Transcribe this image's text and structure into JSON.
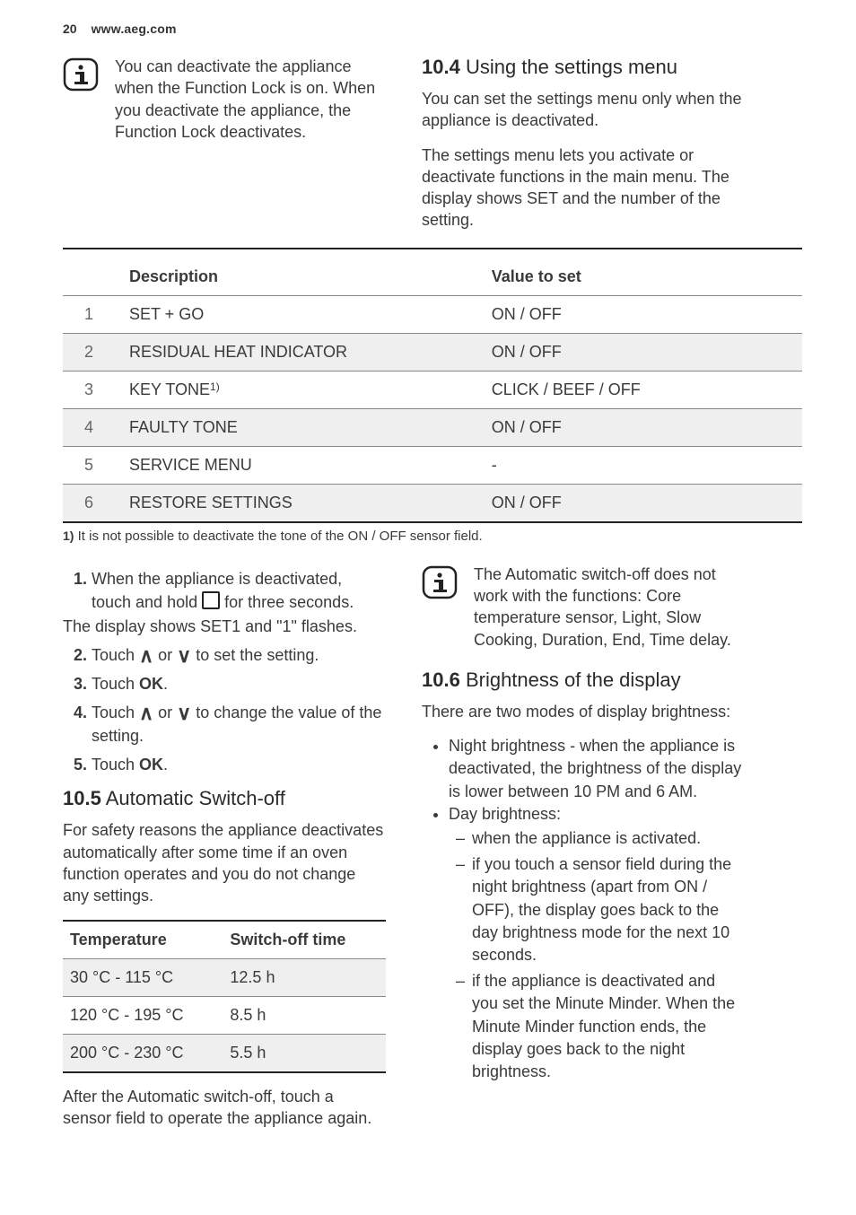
{
  "header": {
    "page": "20",
    "url": "www.aeg.com"
  },
  "note_top": "You can deactivate the appliance when the Function Lock is on. When you deactivate the appliance, the Function Lock deactivates.",
  "s104": {
    "num": "10.4",
    "title": "Using the settings menu",
    "p1": "You can set the settings menu only when the appliance is deactivated.",
    "p2": "The settings menu lets you activate or deactivate functions in the main menu. The display shows SET and the number of the setting."
  },
  "settings_table": {
    "h_blank": "",
    "h_desc": "Description",
    "h_val": "Value to set",
    "rows": [
      {
        "n": "1",
        "desc": "SET + GO",
        "val": "ON / OFF"
      },
      {
        "n": "2",
        "desc": "RESIDUAL HEAT INDICATOR",
        "val": "ON / OFF"
      },
      {
        "n": "3",
        "desc": "KEY TONE",
        "sup": "1)",
        "val": "CLICK / BEEF / OFF"
      },
      {
        "n": "4",
        "desc": "FAULTY TONE",
        "val": "ON / OFF"
      },
      {
        "n": "5",
        "desc": "SERVICE MENU",
        "val": "-"
      },
      {
        "n": "6",
        "desc": "RESTORE SETTINGS",
        "val": "ON / OFF"
      }
    ],
    "footnote_n": "1)",
    "footnote": " It is not possible to deactivate the tone of the ON / OFF sensor field."
  },
  "steps": {
    "s1a": "When the appliance is deactivated, touch and hold ",
    "s1b": " for three seconds.",
    "under1": "The display shows SET1 and \"1\" flashes.",
    "s2a": "Touch ",
    "s2mid": " or ",
    "s2b": " to set the setting.",
    "s3a": "Touch ",
    "s3b": ".",
    "s4a": "Touch ",
    "s4mid": " or ",
    "s4b": " to change the value of the setting.",
    "s5a": "Touch ",
    "s5b": "."
  },
  "s105": {
    "num": "10.5",
    "title": "Automatic Switch-off",
    "p1": "For safety reasons the appliance deactivates automatically after some time if an oven function operates and you do not change any settings.",
    "table": {
      "h_temp": "Temperature",
      "h_time": "Switch-off time",
      "rows": [
        {
          "t": "30 °C - 115 °C",
          "h": "12.5 h"
        },
        {
          "t": "120 °C - 195 °C",
          "h": "8.5 h"
        },
        {
          "t": "200 °C - 230 °C",
          "h": "5.5 h"
        }
      ]
    },
    "p2": "After the Automatic switch-off, touch a sensor field to operate the appliance again."
  },
  "note_right": "The Automatic switch-off does not work with the functions: Core temperature sensor, Light, Slow Cooking, Duration, End, Time delay.",
  "s106": {
    "num": "10.6",
    "title": "Brightness of the display",
    "p1": "There are two modes of display brightness:",
    "bul": [
      "Night brightness - when the appliance is deactivated, the brightness of the display is lower between 10 PM and 6 AM.",
      "Day brightness:"
    ],
    "dash": [
      "when the appliance is activated.",
      "if you touch a sensor field during the night brightness (apart from ON / OFF), the display goes back to the day brightness mode for the next 10 seconds.",
      "if the appliance is deactivated and you set the Minute Minder. When the Minute Minder function ends, the display goes back to the night brightness."
    ]
  }
}
